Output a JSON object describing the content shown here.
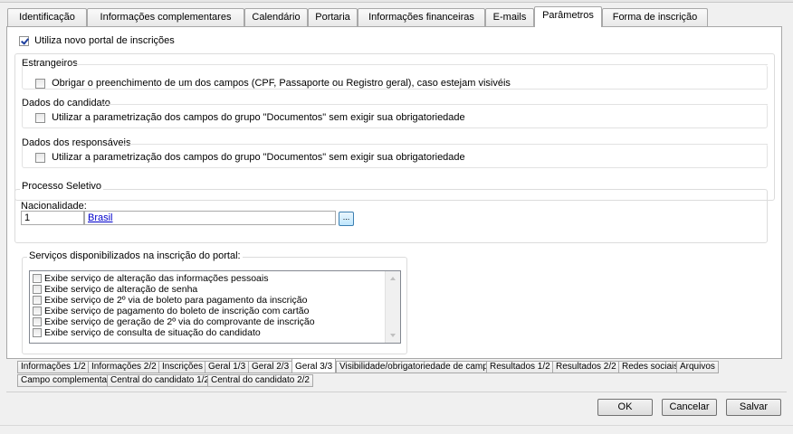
{
  "top_tabs": [
    {
      "label": "Identificação"
    },
    {
      "label": "Informações complementares"
    },
    {
      "label": "Calendário"
    },
    {
      "label": "Portaria"
    },
    {
      "label": "Informações financeiras"
    },
    {
      "label": "E-mails"
    },
    {
      "label": "Parâmetros",
      "active": true
    },
    {
      "label": "Forma de inscrição"
    }
  ],
  "portal": {
    "use_new_portal_label": "Utiliza novo portal de inscrições",
    "use_new_portal_checked": true
  },
  "estrangeiros": {
    "title": "Estrangeiros",
    "option_label": "Obrigar o preenchimento de um dos campos (CPF, Passaporte ou Registro geral), caso estejam visivéis"
  },
  "dados_candidato": {
    "title": "Dados do candidato",
    "option_label": "Utilizar a parametrização dos campos do grupo \"Documentos\" sem exigir sua obrigatoriedade"
  },
  "dados_responsaveis": {
    "title": "Dados dos responsáveis",
    "option_label": "Utilizar a parametrização dos campos do grupo \"Documentos\" sem exigir sua obrigatoriedade"
  },
  "processo_seletivo": {
    "title": "Processo Seletivo",
    "nacionalidade_label": "Nacionalidade:",
    "nacionalidade_code": "1",
    "nacionalidade_name": "Brasil",
    "lookup_button": "..."
  },
  "servicos": {
    "title": "Serviços disponibilizados na inscrição do portal:",
    "items": [
      "Exibe serviço de alteração das informações pessoais",
      "Exibe serviço de alteração de senha",
      "Exibe serviço de 2º via de boleto para pagamento da inscrição",
      "Exibe serviço de pagamento do boleto de inscrição com cartão",
      "Exibe serviço de geração de 2º via do comprovante de inscrição",
      "Exibe serviço de consulta de situação do candidato"
    ]
  },
  "bottom_tabs_row1": [
    "Informações 1/2",
    "Informações 2/2",
    "Inscrições",
    "Geral 1/3",
    "Geral 2/3",
    "Geral 3/3",
    "Visibilidade/obrigatoriedade de campos",
    "Resultados 1/2",
    "Resultados 2/2",
    "Redes sociais",
    "Arquivos"
  ],
  "bottom_tabs_row2": [
    "Campo complementar",
    "Central do candidato 1/2",
    "Central do candidato 2/2"
  ],
  "buttons": {
    "ok": "OK",
    "cancel": "Cancelar",
    "save": "Salvar"
  }
}
